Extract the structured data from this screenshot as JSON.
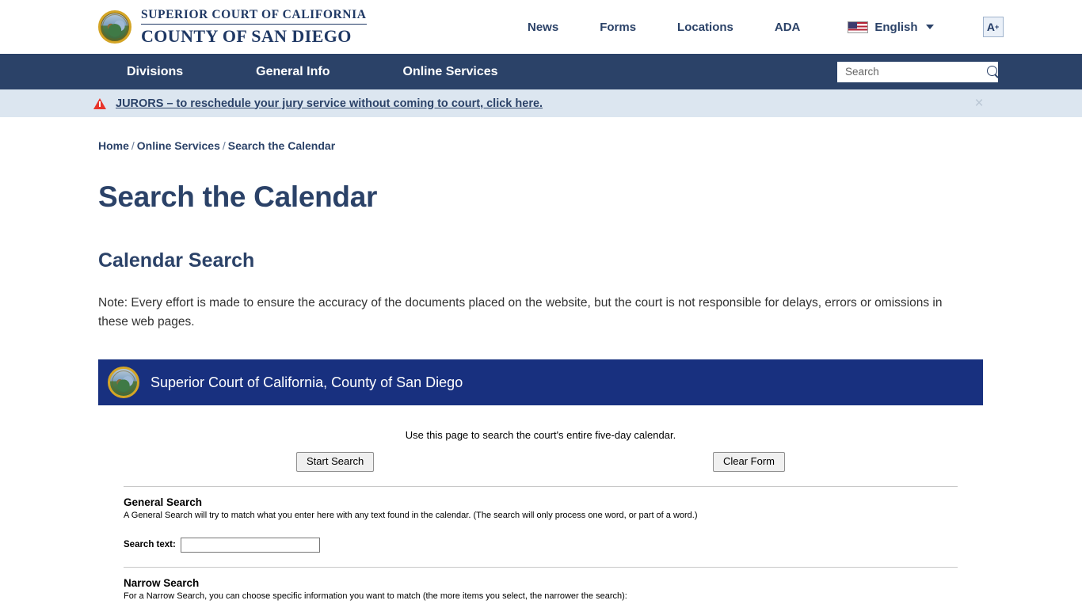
{
  "header": {
    "seal_alt": "california-state-seal",
    "brand_line1": "SUPERIOR COURT OF CALIFORNIA",
    "brand_line2": "COUNTY OF SAN DIEGO",
    "util_links": [
      {
        "label": "News"
      },
      {
        "label": "Forms"
      },
      {
        "label": "Locations"
      },
      {
        "label": "ADA"
      }
    ],
    "language": {
      "label": "English",
      "flag": "us-flag-icon"
    },
    "text_size": {
      "label": "A",
      "sup": "+"
    }
  },
  "nav": {
    "items": [
      {
        "label": "Divisions"
      },
      {
        "label": "General Info"
      },
      {
        "label": "Online Services"
      }
    ],
    "search": {
      "placeholder": "Search",
      "value": "",
      "icon": "search-icon"
    }
  },
  "alert": {
    "icon": "warning-triangle-icon",
    "text": "JURORS – to reschedule your jury service without coming to court, click here.",
    "close_label": "×"
  },
  "breadcrumb": {
    "items": [
      {
        "label": "Home"
      },
      {
        "label": "Online Services"
      },
      {
        "label": "Search the Calendar"
      }
    ],
    "separator": "/"
  },
  "main": {
    "page_title": "Search the Calendar",
    "section_title": "Calendar Search",
    "note": "Note: Every effort is made to ensure the accuracy of the documents placed on the website, but the court is not responsible for delays, errors or omissions in these web pages."
  },
  "widget": {
    "header_title": "Superior Court of California, County of San Diego",
    "header_bg": "#18307f",
    "seal_alt": "california-state-seal",
    "intro": "Use this page to search the court's entire five-day calendar.",
    "start_search_label": "Start Search",
    "clear_form_label": "Clear Form",
    "general_search": {
      "heading": "General Search",
      "description": "A General Search will try to match what you enter here with any text found in the calendar. (The search will only process one word, or part of a word.)",
      "field_label": "Search text:",
      "field_value": "",
      "field_placeholder": ""
    },
    "narrow_search": {
      "heading": "Narrow Search",
      "description": "For a Narrow Search, you can choose specific information you want to match (the more items you select, the narrower the search):"
    }
  },
  "colors": {
    "navy": "#2b4268",
    "widget_blue": "#18307f",
    "alert_bg": "#dce6f0",
    "alert_red": "#e8342a",
    "seal_gold": "#d4a526"
  }
}
